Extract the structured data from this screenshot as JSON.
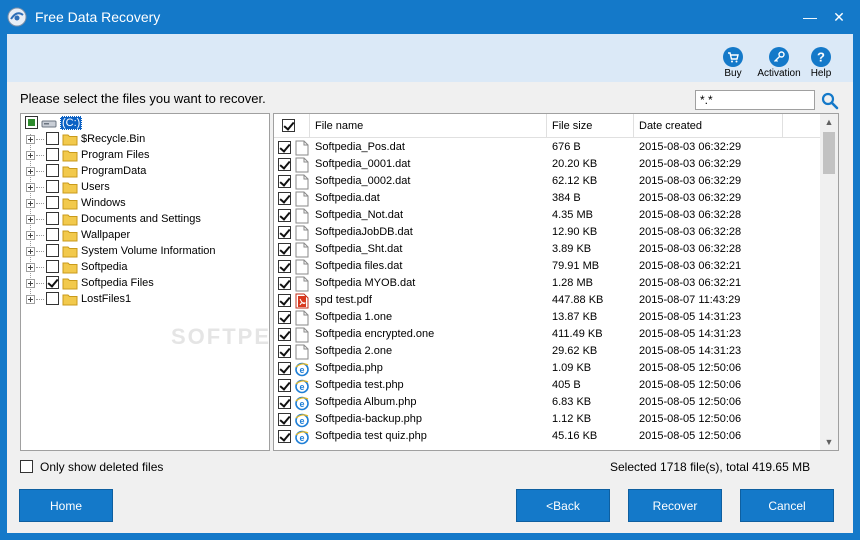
{
  "window": {
    "title": "Free Data Recovery",
    "minimize_glyph": "—",
    "close_glyph": "✕"
  },
  "toolbar": {
    "buy_label": "Buy",
    "activation_label": "Activation",
    "help_label": "Help"
  },
  "prompt": "Please select the files you want to recover.",
  "search": {
    "value": "*.*"
  },
  "tree": {
    "drive_label": "(C:)",
    "folders": [
      {
        "label": "$Recycle.Bin",
        "checked": false
      },
      {
        "label": "Program Files",
        "checked": false
      },
      {
        "label": "ProgramData",
        "checked": false
      },
      {
        "label": "Users",
        "checked": false
      },
      {
        "label": "Windows",
        "checked": false
      },
      {
        "label": "Documents and Settings",
        "checked": false
      },
      {
        "label": "Wallpaper",
        "checked": false
      },
      {
        "label": "System Volume Information",
        "checked": false
      },
      {
        "label": "Softpedia",
        "checked": false
      },
      {
        "label": "Softpedia Files",
        "checked": true
      },
      {
        "label": "LostFiles1",
        "checked": false
      }
    ]
  },
  "list": {
    "headers": {
      "name": "File name",
      "size": "File size",
      "date": "Date created"
    },
    "rows": [
      {
        "name": "Softpedia_Pos.dat",
        "size": "676 B",
        "date": "2015-08-03 06:32:29",
        "type": "generic"
      },
      {
        "name": "Softpedia_0001.dat",
        "size": "20.20 KB",
        "date": "2015-08-03 06:32:29",
        "type": "generic"
      },
      {
        "name": "Softpedia_0002.dat",
        "size": "62.12 KB",
        "date": "2015-08-03 06:32:29",
        "type": "generic"
      },
      {
        "name": "Softpedia.dat",
        "size": "384 B",
        "date": "2015-08-03 06:32:29",
        "type": "generic"
      },
      {
        "name": "Softpedia_Not.dat",
        "size": "4.35 MB",
        "date": "2015-08-03 06:32:28",
        "type": "generic"
      },
      {
        "name": "SoftpediaJobDB.dat",
        "size": "12.90 KB",
        "date": "2015-08-03 06:32:28",
        "type": "generic"
      },
      {
        "name": "Softpedia_Sht.dat",
        "size": "3.89 KB",
        "date": "2015-08-03 06:32:28",
        "type": "generic"
      },
      {
        "name": "Softpedia files.dat",
        "size": "79.91 MB",
        "date": "2015-08-03 06:32:21",
        "type": "generic"
      },
      {
        "name": "Softpedia MYOB.dat",
        "size": "1.28 MB",
        "date": "2015-08-03 06:32:21",
        "type": "generic"
      },
      {
        "name": "spd test.pdf",
        "size": "447.88 KB",
        "date": "2015-08-07 11:43:29",
        "type": "pdf"
      },
      {
        "name": "Softpedia 1.one",
        "size": "13.87 KB",
        "date": "2015-08-05 14:31:23",
        "type": "generic"
      },
      {
        "name": "Softpedia encrypted.one",
        "size": "411.49 KB",
        "date": "2015-08-05 14:31:23",
        "type": "generic"
      },
      {
        "name": "Softpedia 2.one",
        "size": "29.62 KB",
        "date": "2015-08-05 14:31:23",
        "type": "generic"
      },
      {
        "name": "Softpedia.php",
        "size": "1.09 KB",
        "date": "2015-08-05 12:50:06",
        "type": "web"
      },
      {
        "name": "Softpedia test.php",
        "size": "405 B",
        "date": "2015-08-05 12:50:06",
        "type": "web"
      },
      {
        "name": "Softpedia Album.php",
        "size": "6.83 KB",
        "date": "2015-08-05 12:50:06",
        "type": "web"
      },
      {
        "name": "Softpedia-backup.php",
        "size": "1.12 KB",
        "date": "2015-08-05 12:50:06",
        "type": "web"
      },
      {
        "name": "Softpedia test quiz.php",
        "size": "45.16 KB",
        "date": "2015-08-05 12:50:06",
        "type": "web"
      }
    ]
  },
  "filter_label": "Only show deleted files",
  "status": "Selected 1718 file(s), total 419.65 MB",
  "buttons": {
    "home": "Home",
    "back": "<Back",
    "recover": "Recover",
    "cancel": "Cancel"
  },
  "watermark": "SOFTPEDIA",
  "colors": {
    "accent": "#1479c9",
    "toolbar_bg": "#dbe9f7",
    "pdf_red": "#d9391f",
    "web_blue": "#1f7fd6"
  }
}
